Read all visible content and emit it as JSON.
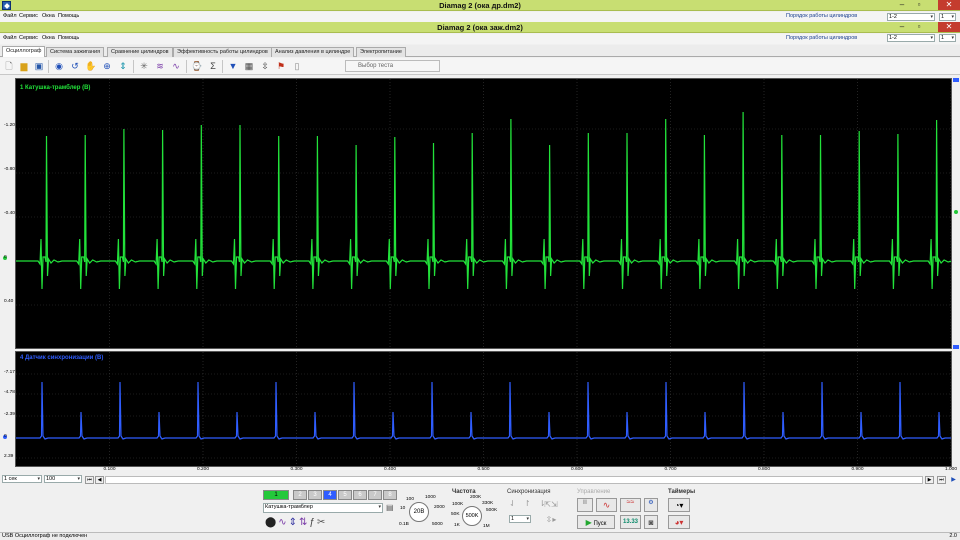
{
  "windows": [
    {
      "title": "Diamag 2 (ока др.dm2)",
      "menu": [
        "Файл",
        "Сервис",
        "Окна",
        "Помощь"
      ],
      "cyl_label": "Порядок работы цилиндров",
      "cyl_value": "1-2",
      "count": "1"
    },
    {
      "title": "Diamag 2 (ока заж.dm2)",
      "menu": [
        "Файл",
        "Сервис",
        "Окна",
        "Помощь"
      ],
      "cyl_label": "Порядок работы цилиндров",
      "cyl_value": "1-2",
      "count": "1"
    }
  ],
  "tabs": [
    "Осциллограф",
    "Система зажигания",
    "Сравнение цилиндров",
    "Эффективность работы цилиндров",
    "Анализ давления в цилиндре",
    "Электропитание"
  ],
  "active_tab": 0,
  "toolbar": {
    "test_select": "Выбор теста"
  },
  "channel1": {
    "label": "1 Катушка-трамблер (В)",
    "color": "#22e23a",
    "yticks": [
      "-1.20",
      "-0.80",
      "-0.40",
      "0",
      "0.40"
    ]
  },
  "channel4": {
    "label": "4 Датчик синхронизации (В)",
    "color": "#2f5dff",
    "yticks": [
      "-7.17",
      "-4.78",
      "-2.39",
      "0",
      "2.39"
    ]
  },
  "xaxis": {
    "ticks": [
      "0.100",
      "0.200",
      "0.300",
      "0.400",
      "0.500",
      "0.600",
      "0.700",
      "0.800",
      "0.900",
      "1.000"
    ]
  },
  "scroll": {
    "timebase": "1 сек",
    "zoom": "100"
  },
  "bottom": {
    "channels": [
      "1",
      "2",
      "3",
      "4",
      "5",
      "6",
      "7",
      "8"
    ],
    "active_channels": [
      "1",
      "4"
    ],
    "channel_select": "Катушка-трамблер",
    "amp": {
      "labels": [
        "100",
        "1000",
        "10",
        "2000",
        "0.1В",
        "5000"
      ],
      "value": "20В"
    },
    "freq": {
      "title": "Частота",
      "labels": [
        "200K",
        "100K",
        "330K",
        "50K",
        "500K",
        "1K",
        "1M"
      ],
      "value": "500K"
    },
    "sync": {
      "title": "Синхронизация",
      "value": "1"
    },
    "control": {
      "title": "Управление",
      "start": "Пуск",
      "value": "13.33"
    },
    "timers": {
      "title": "Таймеры"
    }
  },
  "status": {
    "left": "USB Осциллограф не подключен",
    "right": "2.0"
  },
  "colors": {
    "titlebar": "#c8de72",
    "plot_bg": "#000000",
    "grid": "#3b3b3b"
  }
}
